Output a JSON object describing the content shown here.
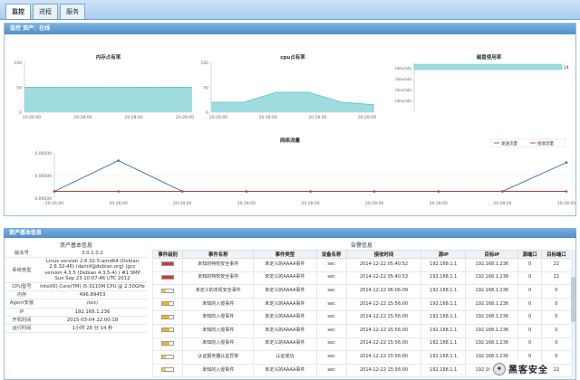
{
  "tabs": [
    "监控",
    "进程",
    "服务"
  ],
  "monitor": {
    "header": "监控 资产：在线"
  },
  "colors": {
    "area_fill": "#9fdcdf",
    "area_stroke": "#53c3c7",
    "net_send": "#2f68b6",
    "net_recv": "#c43a3a",
    "header_blue": "#4f8fca"
  },
  "chart_data": [
    {
      "type": "area",
      "title": "内存占有率",
      "x": [
        "20:26:00",
        "20:28:00",
        "20:28:00",
        "20:28:00"
      ],
      "series": [
        {
          "values": [
            49.9,
            50.0,
            50.1,
            50.2
          ]
        }
      ],
      "ylim": [
        0,
        100
      ],
      "yticks": [
        "100",
        "50",
        "0"
      ]
    },
    {
      "type": "area",
      "title": "cpu占有率",
      "x": [
        "20:26:00",
        "20:28:00",
        "20:28:00",
        "20:28:00"
      ],
      "series": [
        {
          "values": [
            20,
            20,
            40,
            40,
            20,
            15
          ]
        }
      ],
      "ylim": [
        0,
        100
      ],
      "yticks": [
        "100",
        "50",
        "0"
      ]
    },
    {
      "type": "bar",
      "title": "磁盘使用率",
      "categories": [
        "/dev/sda",
        "/dev/sda",
        "/dev/sda",
        "/dev/sda"
      ],
      "values": [
        24
      ],
      "value_label": "24",
      "ylim": [
        0,
        100
      ]
    },
    {
      "type": "line",
      "title": "网络流量",
      "x": [
        "20:26:00",
        "20:28:00",
        "20:28:00",
        "20:28:00",
        "20:28:00",
        "20:28:00",
        "20:28:00",
        "20:28:00",
        "20:28:00"
      ],
      "yticks": [
        "0.00000",
        "0.00000",
        "0.00000"
      ],
      "ylim": [
        0,
        1
      ],
      "series": [
        {
          "name": "发送流量",
          "values": [
            0,
            0.8,
            0,
            0,
            0,
            0,
            0,
            0,
            0.75
          ]
        },
        {
          "name": "接收流量",
          "values": [
            0,
            0,
            0,
            0,
            0,
            0,
            0,
            0,
            0
          ]
        }
      ],
      "legend": "top-right"
    }
  ],
  "asset": {
    "header": "资产基本信息",
    "basic_title": "资产基本信息",
    "alarm_title": "告警信息",
    "rows": [
      {
        "label": "版本号",
        "value": "3.0.1.0.2"
      },
      {
        "label": "系统类型",
        "value": "Linux version 2.6.32-5-amd64 (Debian 2.6.32-46) (dannf@debian.org) (gcc version 4.3.5 (Debian 4.3.5-4) ) #1 SMP Sun Sep 23 10:07:46 UTC 2012"
      },
      {
        "label": "CPU型号",
        "value": "Intel(R) Core(TM) i5-3210M CPU @ 2.50GHz"
      },
      {
        "label": "内存",
        "value": "496.89453"
      },
      {
        "label": "Agent安装",
        "value": "/sec/"
      },
      {
        "label": "IP",
        "value": "192.168.1.236"
      },
      {
        "label": "开机时间",
        "value": "2015-03-04 22:00:18"
      },
      {
        "label": "运行时间",
        "value": "1小时 28 分 14 秒"
      }
    ],
    "alarm_headers": [
      "事件级别",
      "事件名称",
      "事件类型",
      "设备名称",
      "接收时间",
      "源IP",
      "目标IP",
      "源端口",
      "目标端口"
    ],
    "alarm_rows": [
      {
        "level": 3,
        "name": "未知的特权安全事件",
        "type": "未定义的AAAA事件",
        "device": "sec",
        "time": "2014-12-22 05:40:52",
        "src": "192.168.1.1",
        "dst": "192.168.1.236",
        "sport": "0",
        "dport": "22"
      },
      {
        "level": 3,
        "name": "未知的特权安全事件",
        "type": "未定义的AAAA事件",
        "device": "sec",
        "time": "2014-12-22 05:40:53",
        "src": "192.168.1.1",
        "dst": "192.168.1.236",
        "sport": "0",
        "dport": "22"
      },
      {
        "level": 1,
        "name": "未定义的本机安全事件",
        "type": "未定义的AAAA事件",
        "device": "sec",
        "time": "2014-12-22 06:06:09",
        "src": "192.168.1.1",
        "dst": "192.168.1.236",
        "sport": "0",
        "dport": "0"
      },
      {
        "level": 2,
        "name": "未知的入侵事件",
        "type": "未定义的AAAA事件",
        "device": "sec",
        "time": "2014-12-22 15:56:00",
        "src": "192.168.1.1",
        "dst": "192.168.1.236",
        "sport": "0",
        "dport": "0"
      },
      {
        "level": 2,
        "name": "未知的入侵事件",
        "type": "未定义的AAAA事件",
        "device": "sec",
        "time": "2014-12-22 15:56:00",
        "src": "192.168.1.1",
        "dst": "192.168.1.236",
        "sport": "0",
        "dport": "0"
      },
      {
        "level": 2,
        "name": "未知的入侵事件",
        "type": "未定义的AAAA事件",
        "device": "sec",
        "time": "2014-12-22 15:56:00",
        "src": "192.168.1.1",
        "dst": "192.168.1.236",
        "sport": "0",
        "dport": "0"
      },
      {
        "level": 2,
        "name": "未知的入侵事件",
        "type": "未定义的AAAA事件",
        "device": "sec",
        "time": "2014-12-22 15:56:00",
        "src": "192.168.1.1",
        "dst": "192.168.1.236",
        "sport": "0",
        "dport": "0"
      },
      {
        "level": 1,
        "name": "认证服务器认证异常",
        "type": "认证成功",
        "device": "sec",
        "time": "2014-12-22 15:56:00",
        "src": "192.168.1.1",
        "dst": "192.168.1.236",
        "sport": "0",
        "dport": "0"
      },
      {
        "level": 1,
        "name": "未知的入侵事件",
        "type": "未定义的AAAA事件",
        "device": "sec",
        "time": "2014-12-22 15:56:00",
        "src": "192.168.1.1",
        "dst": "192.168.1.236",
        "sport": "22",
        "dport": "22"
      }
    ]
  },
  "watermark": {
    "text": "黑客安全",
    "logo_char": "✦"
  }
}
